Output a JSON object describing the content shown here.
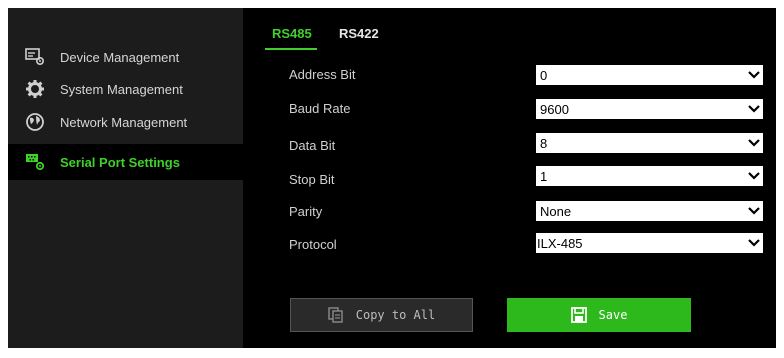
{
  "sidebar": {
    "items": [
      {
        "label": "Device Management",
        "icon": "device-management-icon"
      },
      {
        "label": "System Management",
        "icon": "gear-icon"
      },
      {
        "label": "Network Management",
        "icon": "globe-icon"
      },
      {
        "label": "Serial Port Settings",
        "icon": "serial-port-icon",
        "active": true
      }
    ]
  },
  "tabs": [
    {
      "label": "RS485",
      "active": true
    },
    {
      "label": "RS422",
      "active": false
    }
  ],
  "form": {
    "address_bit": {
      "label": "Address Bit",
      "value": "0"
    },
    "baud_rate": {
      "label": "Baud Rate",
      "value": "9600"
    },
    "data_bit": {
      "label": "Data Bit",
      "value": "8"
    },
    "stop_bit": {
      "label": "Stop Bit",
      "value": "1"
    },
    "parity": {
      "label": "Parity",
      "value": "None"
    },
    "protocol": {
      "label": "Protocol",
      "value": "ILX-485"
    }
  },
  "buttons": {
    "copy_label": "Copy to All",
    "save_label": "Save"
  },
  "colors": {
    "accent": "#3fd12a",
    "save": "#2db81c",
    "panel": "#000000",
    "sidebar": "#1c1c1c"
  }
}
